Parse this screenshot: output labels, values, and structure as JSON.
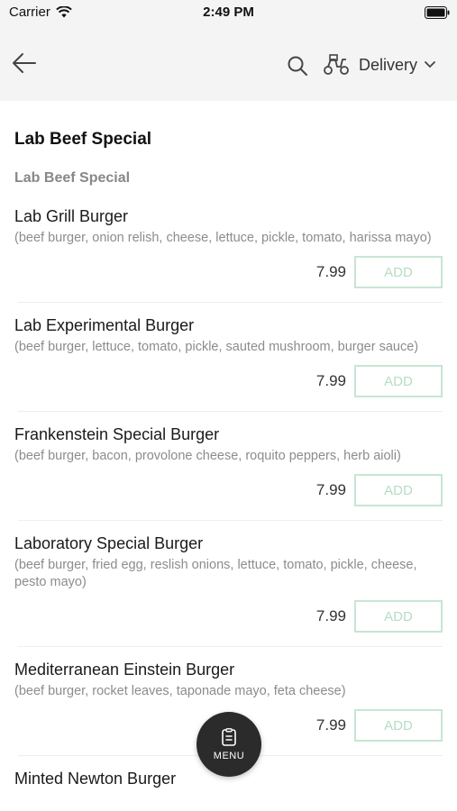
{
  "status_bar": {
    "carrier": "Carrier",
    "time": "2:49 PM"
  },
  "nav": {
    "delivery_label": "Delivery"
  },
  "category": {
    "title": "Lab Beef Special",
    "subtitle": "Lab Beef Special"
  },
  "add_label": "ADD",
  "items": [
    {
      "name": "Lab Grill Burger",
      "description": "(beef burger, onion relish, cheese, lettuce, pickle, tomato, harissa mayo)",
      "price": "7.99"
    },
    {
      "name": "Lab Experimental Burger",
      "description": "(beef burger, lettuce, tomato, pickle, sauted mushroom, burger sauce)",
      "price": "7.99"
    },
    {
      "name": "Frankenstein Special Burger",
      "description": "(beef burger, bacon, provolone cheese, roquito peppers, herb aioli)",
      "price": "7.99"
    },
    {
      "name": "Laboratory Special Burger",
      "description": "(beef burger, fried egg, reslish onions, lettuce, tomato, pickle, cheese, pesto mayo)",
      "price": "7.99"
    },
    {
      "name": "Mediterranean Einstein Burger",
      "description": "(beef burger, rocket leaves, taponade mayo, feta cheese)",
      "price": "7.99"
    },
    {
      "name": "Minted Newton Burger",
      "description": "",
      "price": ""
    }
  ],
  "menu_fab": {
    "label": "MENU"
  }
}
